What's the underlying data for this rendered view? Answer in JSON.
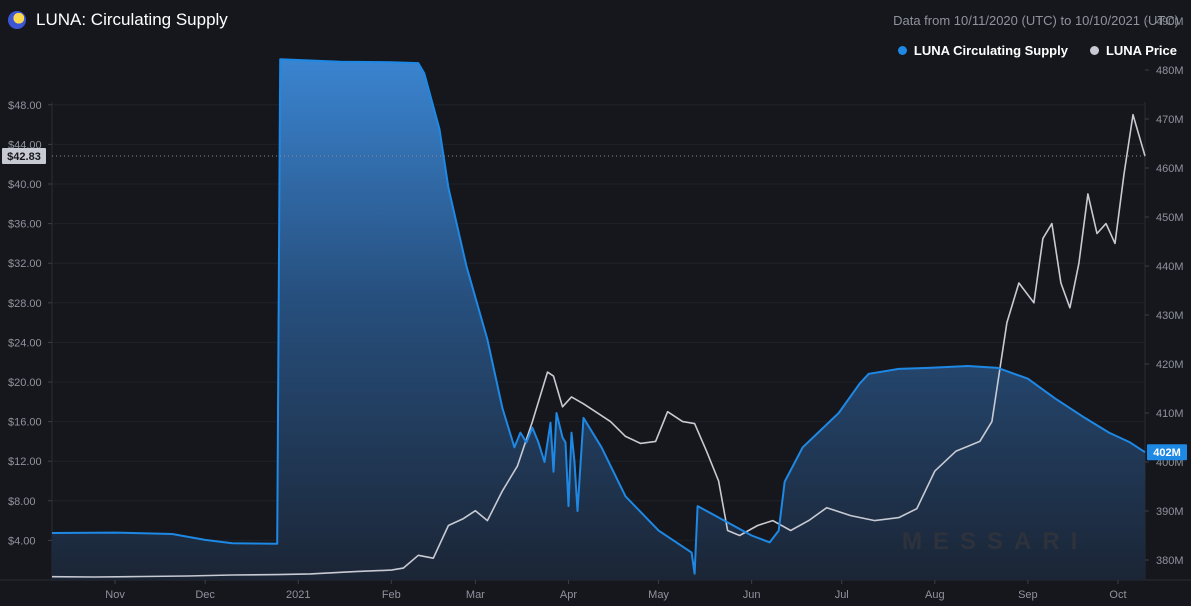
{
  "header": {
    "title": "LUNA: Circulating Supply",
    "date_range": "Data from 10/11/2020 (UTC) to 10/10/2021 (UTC)",
    "logo_icon": "luna-logo-icon"
  },
  "legend": [
    {
      "label": "LUNA Circulating Supply",
      "color": "#1e88e5"
    },
    {
      "label": "LUNA Price",
      "color": "#c8cad3"
    }
  ],
  "watermark": "MESSARI",
  "chart_data": {
    "type": "line",
    "title": "LUNA: Circulating Supply",
    "x_range": [
      "2020-10-11",
      "2021-10-10"
    ],
    "x_tick_labels": [
      {
        "date": "2020-11-01",
        "label": "Nov"
      },
      {
        "date": "2020-12-01",
        "label": "Dec"
      },
      {
        "date": "2021-01-01",
        "label": "2021"
      },
      {
        "date": "2021-02-01",
        "label": "Feb"
      },
      {
        "date": "2021-03-01",
        "label": "Mar"
      },
      {
        "date": "2021-04-01",
        "label": "Apr"
      },
      {
        "date": "2021-05-01",
        "label": "May"
      },
      {
        "date": "2021-06-01",
        "label": "Jun"
      },
      {
        "date": "2021-07-01",
        "label": "Jul"
      },
      {
        "date": "2021-08-01",
        "label": "Aug"
      },
      {
        "date": "2021-09-01",
        "label": "Sep"
      },
      {
        "date": "2021-10-01",
        "label": "Oct"
      }
    ],
    "y_left": {
      "label": "LUNA Price",
      "range": [
        0,
        50
      ],
      "ticks": [
        4,
        8,
        12,
        16,
        20,
        24,
        28,
        32,
        36,
        40,
        44,
        48
      ],
      "tick_labels": [
        "$4.00",
        "$8.00",
        "$12.00",
        "$16.00",
        "$20.00",
        "$24.00",
        "$28.00",
        "$32.00",
        "$36.00",
        "$40.00",
        "$44.00",
        "$48.00"
      ]
    },
    "y_right": {
      "label": "LUNA Circulating Supply",
      "range_millions": [
        377,
        495
      ],
      "ticks": [
        380,
        390,
        400,
        410,
        420,
        430,
        440,
        450,
        460,
        470,
        480,
        490
      ],
      "tick_labels": [
        "380M",
        "390M",
        "400M",
        "410M",
        "420M",
        "430M",
        "440M",
        "450M",
        "460M",
        "470M",
        "480M",
        "490M"
      ]
    },
    "current_price_label": "$42.83",
    "current_price": 42.83,
    "current_supply_label": "402M",
    "current_supply_millions": 402,
    "series": [
      {
        "name": "LUNA Circulating Supply",
        "axis": "right",
        "unit": "millions",
        "color": "#1e88e5",
        "points": [
          [
            "2020-10-11",
            385.5
          ],
          [
            "2020-11-01",
            385.6
          ],
          [
            "2020-11-20",
            385.3
          ],
          [
            "2020-12-01",
            384.1
          ],
          [
            "2020-12-10",
            383.4
          ],
          [
            "2020-12-25",
            383.3
          ],
          [
            "2020-12-26",
            482.2
          ],
          [
            "2021-01-15",
            481.7
          ],
          [
            "2021-02-01",
            481.6
          ],
          [
            "2021-02-10",
            481.4
          ],
          [
            "2021-02-12",
            479.3
          ],
          [
            "2021-02-17",
            468.0
          ],
          [
            "2021-02-20",
            456.0
          ],
          [
            "2021-02-26",
            440.0
          ],
          [
            "2021-03-05",
            425.0
          ],
          [
            "2021-03-10",
            411.0
          ],
          [
            "2021-03-14",
            403.0
          ],
          [
            "2021-03-16",
            406.0
          ],
          [
            "2021-03-18",
            404.0
          ],
          [
            "2021-03-20",
            407.0
          ],
          [
            "2021-03-22",
            404.0
          ],
          [
            "2021-03-24",
            400.0
          ],
          [
            "2021-03-26",
            408.0
          ],
          [
            "2021-03-27",
            398.0
          ],
          [
            "2021-03-28",
            410.0
          ],
          [
            "2021-03-30",
            405.0
          ],
          [
            "2021-03-31",
            404.0
          ],
          [
            "2021-04-01",
            391.0
          ],
          [
            "2021-04-02",
            406.0
          ],
          [
            "2021-04-03",
            400.0
          ],
          [
            "2021-04-04",
            390.0
          ],
          [
            "2021-04-06",
            409.0
          ],
          [
            "2021-04-12",
            403.0
          ],
          [
            "2021-04-20",
            393.0
          ],
          [
            "2021-05-01",
            386.0
          ],
          [
            "2021-05-12",
            381.5
          ],
          [
            "2021-05-13",
            377.2
          ],
          [
            "2021-05-14",
            391.0
          ],
          [
            "2021-05-20",
            389.0
          ],
          [
            "2021-06-01",
            385.0
          ],
          [
            "2021-06-07",
            383.6
          ],
          [
            "2021-06-10",
            386.0
          ],
          [
            "2021-06-12",
            396.0
          ],
          [
            "2021-06-18",
            403.0
          ],
          [
            "2021-06-30",
            410.0
          ],
          [
            "2021-07-07",
            416.0
          ],
          [
            "2021-07-10",
            418.0
          ],
          [
            "2021-07-20",
            419.0
          ],
          [
            "2021-07-30",
            419.2
          ],
          [
            "2021-08-12",
            419.6
          ],
          [
            "2021-08-22",
            419.2
          ],
          [
            "2021-09-01",
            417.0
          ],
          [
            "2021-09-10",
            413.0
          ],
          [
            "2021-09-20",
            409.0
          ],
          [
            "2021-09-28",
            406.0
          ],
          [
            "2021-10-05",
            404.0
          ],
          [
            "2021-10-10",
            402.0
          ]
        ]
      },
      {
        "name": "LUNA Price",
        "axis": "left",
        "unit": "USD",
        "color": "#c8cad3",
        "points": [
          [
            "2020-10-11",
            0.33
          ],
          [
            "2020-10-25",
            0.3
          ],
          [
            "2020-11-10",
            0.35
          ],
          [
            "2020-11-25",
            0.4
          ],
          [
            "2020-12-10",
            0.5
          ],
          [
            "2020-12-25",
            0.55
          ],
          [
            "2021-01-05",
            0.62
          ],
          [
            "2021-01-20",
            0.85
          ],
          [
            "2021-02-01",
            1.0
          ],
          [
            "2021-02-05",
            1.2
          ],
          [
            "2021-02-10",
            2.5
          ],
          [
            "2021-02-15",
            2.2
          ],
          [
            "2021-02-20",
            5.5
          ],
          [
            "2021-02-25",
            6.2
          ],
          [
            "2021-03-01",
            7.0
          ],
          [
            "2021-03-05",
            6.0
          ],
          [
            "2021-03-10",
            9.0
          ],
          [
            "2021-03-15",
            11.5
          ],
          [
            "2021-03-20",
            16.0
          ],
          [
            "2021-03-25",
            21.0
          ],
          [
            "2021-03-27",
            20.6
          ],
          [
            "2021-03-30",
            17.5
          ],
          [
            "2021-04-02",
            18.5
          ],
          [
            "2021-04-06",
            17.8
          ],
          [
            "2021-04-10",
            17.0
          ],
          [
            "2021-04-15",
            16.0
          ],
          [
            "2021-04-20",
            14.5
          ],
          [
            "2021-04-25",
            13.8
          ],
          [
            "2021-04-30",
            14.0
          ],
          [
            "2021-05-04",
            17.0
          ],
          [
            "2021-05-09",
            16.0
          ],
          [
            "2021-05-13",
            15.8
          ],
          [
            "2021-05-17",
            13.0
          ],
          [
            "2021-05-21",
            10.0
          ],
          [
            "2021-05-24",
            5.0
          ],
          [
            "2021-05-28",
            4.5
          ],
          [
            "2021-06-03",
            5.5
          ],
          [
            "2021-06-08",
            6.0
          ],
          [
            "2021-06-14",
            5.0
          ],
          [
            "2021-06-20",
            6.0
          ],
          [
            "2021-06-26",
            7.3
          ],
          [
            "2021-07-04",
            6.5
          ],
          [
            "2021-07-12",
            6.0
          ],
          [
            "2021-07-20",
            6.3
          ],
          [
            "2021-07-26",
            7.2
          ],
          [
            "2021-08-01",
            11.0
          ],
          [
            "2021-08-08",
            13.0
          ],
          [
            "2021-08-16",
            14.0
          ],
          [
            "2021-08-20",
            16.0
          ],
          [
            "2021-08-25",
            26.0
          ],
          [
            "2021-08-29",
            30.0
          ],
          [
            "2021-09-03",
            28.0
          ],
          [
            "2021-09-06",
            34.5
          ],
          [
            "2021-09-09",
            36.0
          ],
          [
            "2021-09-12",
            30.0
          ],
          [
            "2021-09-15",
            27.5
          ],
          [
            "2021-09-18",
            32.0
          ],
          [
            "2021-09-21",
            39.0
          ],
          [
            "2021-09-24",
            35.0
          ],
          [
            "2021-09-27",
            36.0
          ],
          [
            "2021-09-30",
            34.0
          ],
          [
            "2021-10-03",
            41.0
          ],
          [
            "2021-10-06",
            47.0
          ],
          [
            "2021-10-10",
            42.83
          ]
        ]
      }
    ]
  }
}
